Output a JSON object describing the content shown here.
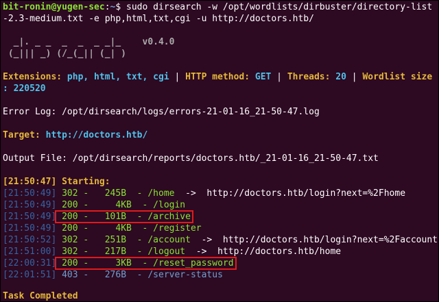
{
  "prompt": {
    "user_host": "bit-ronin@yugen-sec",
    "path": "~",
    "symbol": "$"
  },
  "command": {
    "line1": " sudo dirsearch -w /opt/wordlists/dirbuster/directory-list",
    "line2": "-2.3-medium.txt -e php,html,txt,cgi -u http://doctors.htb/"
  },
  "banner": {
    "art1": "  _|. _ _  _  _  _ _|_    ",
    "art2": " (_||| _) (/_(_|| (_| )   ",
    "version": "v0.4.0"
  },
  "config": {
    "ext_label": "Extensions: ",
    "ext_value": "php, html, txt, cgi",
    "method_label": "HTTP method: ",
    "method_value": "GET",
    "threads_label": "Threads: ",
    "threads_value": "20",
    "wordlist_label": "Wordlist size",
    "wordlist_value": ": 220520",
    "sep": " | "
  },
  "error_log": "Error Log: /opt/dirsearch/logs/errors-21-01-16_21-50-47.log",
  "target": {
    "label": "Target: ",
    "value": "http://doctors.htb/"
  },
  "output_file": "Output File: /opt/dirsearch/reports/doctors.htb/_21-01-16_21-50-47.txt",
  "starting": {
    "time": "[21:50:47]",
    "label": " Starting:"
  },
  "results": [
    {
      "time": "[21:50:49]",
      "code": "302",
      "size": "  245B",
      "path": "/home",
      "redirect": "  ->  http://doctors.htb/login?next=%2Fhome",
      "highlight": false
    },
    {
      "time": "[21:50:49]",
      "code": "200",
      "size": "    4KB",
      "path": "/login",
      "redirect": "",
      "highlight": false
    },
    {
      "time": "[21:50:49]",
      "code": "200",
      "size": "  101B",
      "path": "/archive",
      "redirect": "",
      "highlight": true
    },
    {
      "time": "[21:50:49]",
      "code": "200",
      "size": "    4KB",
      "path": "/register",
      "redirect": "",
      "highlight": false
    },
    {
      "time": "[21:50:52]",
      "code": "302",
      "size": "  251B",
      "path": "/account",
      "redirect": "  ->  http://doctors.htb/login?next=%2Faccount",
      "highlight": false
    },
    {
      "time": "[21:51:00]",
      "code": "302",
      "size": "  217B",
      "path": "/logout",
      "redirect": "  ->  http://doctors.htb/home",
      "highlight": false
    },
    {
      "time": "[22:00:31]",
      "code": "200",
      "size": "    3KB",
      "path": "/reset_password",
      "redirect": "",
      "highlight": true
    },
    {
      "time": "[22:01:51]",
      "code": "403",
      "size": "  276B",
      "path": "/server-status",
      "redirect": "",
      "highlight": false
    }
  ],
  "completed": "Task Completed",
  "colors": {
    "background": "#2d0922",
    "prompt_user": "#8ae234",
    "prompt_path": "#729fcf",
    "config": "#e5b83a",
    "value": "#4fc1e9",
    "status": "#8ae234",
    "highlight": "#e01b1b"
  }
}
